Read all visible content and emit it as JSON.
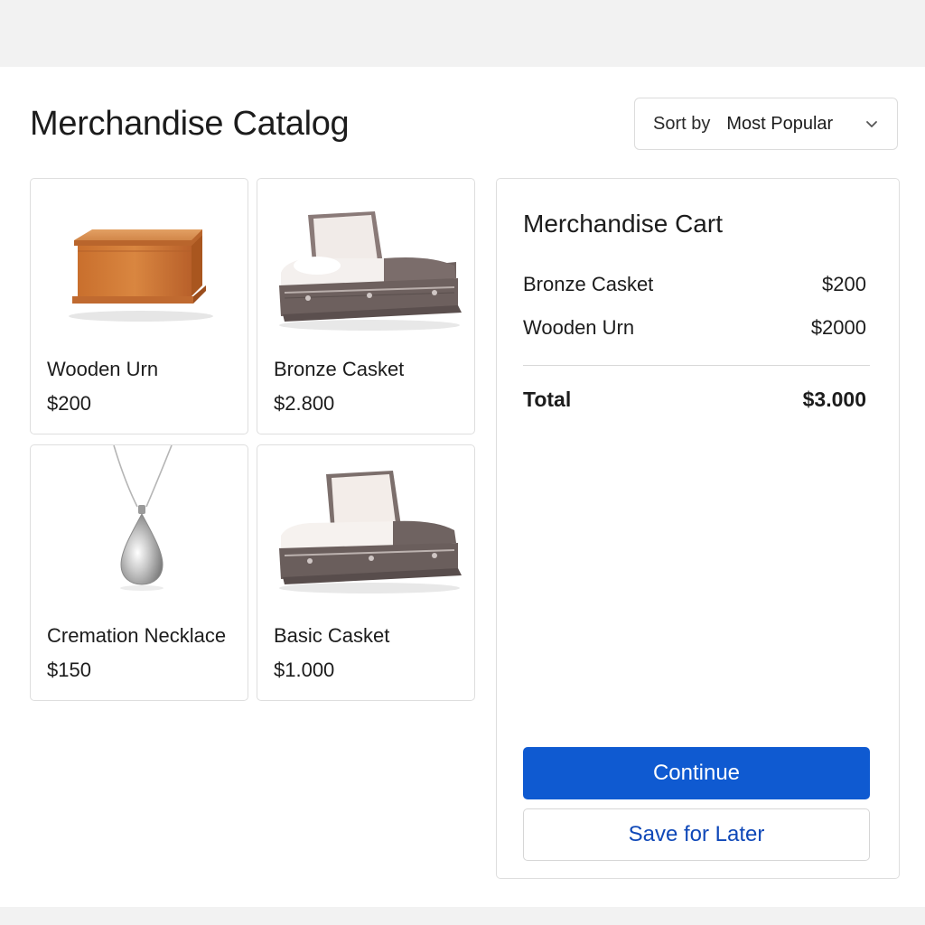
{
  "header": {
    "title": "Merchandise Catalog"
  },
  "sort": {
    "label": "Sort by",
    "value": "Most Popular",
    "icon": "chevron-down-icon"
  },
  "products": [
    {
      "name": "Wooden Urn",
      "price": "$200",
      "image": "wooden-urn-image"
    },
    {
      "name": "Bronze Casket",
      "price": "$2.800",
      "image": "bronze-casket-image"
    },
    {
      "name": "Cremation Necklace",
      "price": "$150",
      "image": "cremation-necklace-image"
    },
    {
      "name": "Basic Casket",
      "price": "$1.000",
      "image": "basic-casket-image"
    }
  ],
  "cart": {
    "title": "Merchandise Cart",
    "items": [
      {
        "name": "Bronze Casket",
        "price": "$200"
      },
      {
        "name": "Wooden Urn",
        "price": "$2000"
      }
    ],
    "total_label": "Total",
    "total_value": "$3.000",
    "continue_label": "Continue",
    "save_label": "Save for Later"
  },
  "colors": {
    "primary": "#0f5ad1",
    "link": "#0f48b8",
    "border": "#dedede",
    "background": "#f2f2f2"
  }
}
